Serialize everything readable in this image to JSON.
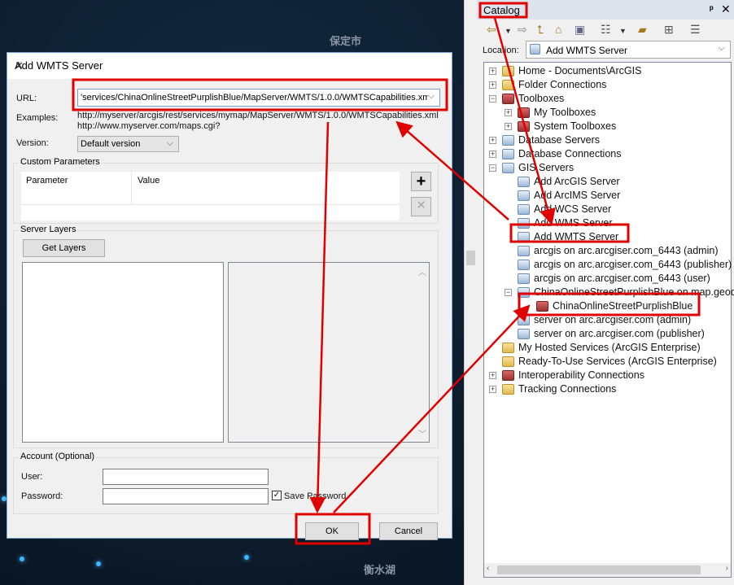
{
  "map": {
    "labels": [
      "保定市",
      "衡水湖"
    ]
  },
  "dialog": {
    "title": "Add WMTS Server",
    "url_label": "URL:",
    "url_value": "'services/ChinaOnlineStreetPurplishBlue/MapServer/WMTS/1.0.0/WMTSCapabilities.xml",
    "examples_label": "Examples:",
    "examples": [
      "http://myserver/arcgis/rest/services/mymap/MapServer/WMTS/1.0.0/WMTSCapabilities.xml",
      "http://www.myserver.com/maps.cgi?"
    ],
    "version_label": "Version:",
    "version_value": "Default version",
    "custom_params_title": "Custom Parameters",
    "param_headers": [
      "Parameter",
      "Value"
    ],
    "server_layers_title": "Server Layers",
    "get_layers": "Get Layers",
    "account_title": "Account (Optional)",
    "user_label": "User:",
    "password_label": "Password:",
    "save_password": "Save Password",
    "save_password_checked": true,
    "ok": "OK",
    "cancel": "Cancel"
  },
  "catalog": {
    "title": "Catalog",
    "location_label": "Location:",
    "location_value": "Add WMTS Server",
    "tree": [
      {
        "label": "Home - Documents\\ArcGIS",
        "level": 0,
        "exp": "+",
        "icon": "folder"
      },
      {
        "label": "Folder Connections",
        "level": 0,
        "exp": "+",
        "icon": "folder"
      },
      {
        "label": "Toolboxes",
        "level": 0,
        "exp": "-",
        "icon": "tool"
      },
      {
        "label": "My Toolboxes",
        "level": 1,
        "exp": "+",
        "icon": "tool"
      },
      {
        "label": "System Toolboxes",
        "level": 1,
        "exp": "+",
        "icon": "tool"
      },
      {
        "label": "Database Servers",
        "level": 0,
        "exp": "+",
        "icon": "server"
      },
      {
        "label": "Database Connections",
        "level": 0,
        "exp": "+",
        "icon": "server"
      },
      {
        "label": "GIS Servers",
        "level": 0,
        "exp": "-",
        "icon": "server"
      },
      {
        "label": "Add ArcGIS Server",
        "level": 1,
        "exp": "",
        "icon": "server"
      },
      {
        "label": "Add ArcIMS Server",
        "level": 1,
        "exp": "",
        "icon": "server"
      },
      {
        "label": "Add WCS Server",
        "level": 1,
        "exp": "",
        "icon": "server"
      },
      {
        "label": "Add WMS Server",
        "level": 1,
        "exp": "",
        "icon": "server"
      },
      {
        "label": "Add WMTS Server",
        "level": 1,
        "exp": "",
        "icon": "server"
      },
      {
        "label": "arcgis on arc.arcgiser.com_6443 (admin)",
        "level": 1,
        "exp": "",
        "icon": "server"
      },
      {
        "label": "arcgis on arc.arcgiser.com_6443 (publisher)",
        "level": 1,
        "exp": "",
        "icon": "server"
      },
      {
        "label": "arcgis on arc.arcgiser.com_6443 (user)",
        "level": 1,
        "exp": "",
        "icon": "server"
      },
      {
        "label": "ChinaOnlineStreetPurplishBlue on map.geoq.cn",
        "level": 1,
        "exp": "-",
        "icon": "server"
      },
      {
        "label": "ChinaOnlineStreetPurplishBlue",
        "level": 2,
        "exp": "",
        "icon": "tool"
      },
      {
        "label": "server on arc.arcgiser.com (admin)",
        "level": 1,
        "exp": "",
        "icon": "server"
      },
      {
        "label": "server on arc.arcgiser.com (publisher)",
        "level": 1,
        "exp": "",
        "icon": "server"
      },
      {
        "label": "My Hosted Services (ArcGIS Enterprise)",
        "level": 0,
        "exp": "",
        "icon": "folder"
      },
      {
        "label": "Ready-To-Use Services (ArcGIS Enterprise)",
        "level": 0,
        "exp": "",
        "icon": "folder"
      },
      {
        "label": "Interoperability Connections",
        "level": 0,
        "exp": "+",
        "icon": "tool"
      },
      {
        "label": "Tracking Connections",
        "level": 0,
        "exp": "+",
        "icon": "folder"
      }
    ]
  },
  "annotation_color": "#e00000"
}
